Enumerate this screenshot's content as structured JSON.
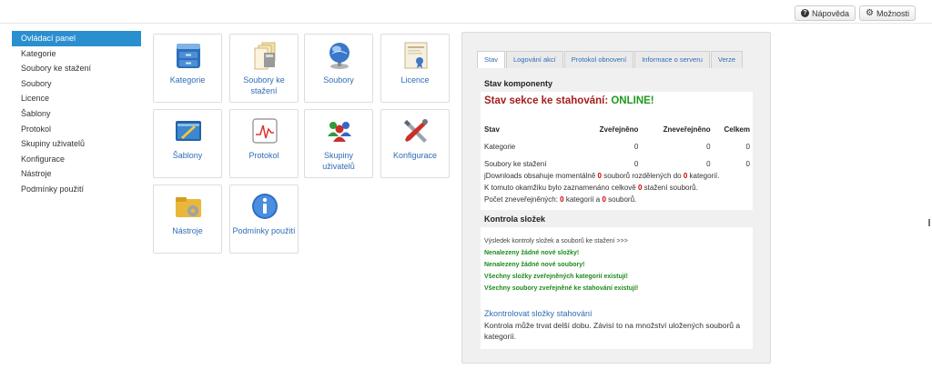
{
  "header": {
    "help_label": "Nápověda",
    "options_label": "Možnosti"
  },
  "sidebar": {
    "items": [
      {
        "label": "Ovládací panel"
      },
      {
        "label": "Kategorie"
      },
      {
        "label": "Soubory ke stažení"
      },
      {
        "label": "Soubory"
      },
      {
        "label": "Licence"
      },
      {
        "label": "Šablony"
      },
      {
        "label": "Protokol"
      },
      {
        "label": "Skupiny uživatelů"
      },
      {
        "label": "Konfigurace"
      },
      {
        "label": "Nástroje"
      },
      {
        "label": "Podmínky použití"
      }
    ]
  },
  "tiles": [
    {
      "label": "Kategorie",
      "icon": "cabinet-icon"
    },
    {
      "label": "Soubory ke stažení",
      "icon": "files-icon"
    },
    {
      "label": "Soubory",
      "icon": "globe-icon"
    },
    {
      "label": "Licence",
      "icon": "certificate-icon"
    },
    {
      "label": "Šablony",
      "icon": "template-icon"
    },
    {
      "label": "Protokol",
      "icon": "chart-log-icon"
    },
    {
      "label": "Skupiny uživatelů",
      "icon": "users-icon"
    },
    {
      "label": "Konfigurace",
      "icon": "tools-icon"
    },
    {
      "label": "Nástroje",
      "icon": "gear-folder-icon"
    },
    {
      "label": "Podmínky použití",
      "icon": "info-icon"
    }
  ],
  "panel": {
    "tabs": [
      {
        "label": "Stav"
      },
      {
        "label": "Logování akcí"
      },
      {
        "label": "Protokol obnovení"
      },
      {
        "label": "Informace o serveru"
      },
      {
        "label": "Verze"
      }
    ],
    "status_title": "Stav komponenty",
    "online_prefix": "Stav sekce ke stahování: ",
    "online_value": "ONLINE!",
    "table": {
      "headers": [
        "Stav",
        "Zveřejněno",
        "Zneveřejněno",
        "Celkem"
      ],
      "rows": [
        [
          "Kategorie",
          "0",
          "0",
          "0"
        ],
        [
          "Soubory ke stažení",
          "0",
          "0",
          "0"
        ]
      ]
    },
    "info": {
      "l1a": "jDownloads obsahuje momentálně ",
      "l1b": "0",
      "l1c": " souborů rozdělených do ",
      "l1d": "0",
      "l1e": " kategorií.",
      "l2a": "K tomuto okamžiku bylo zaznamenáno celkově ",
      "l2b": "0",
      "l2c": " stažení souborů.",
      "l3a": "Počet zneveřejněných: ",
      "l3b": "0",
      "l3c": " kategorií a ",
      "l3d": "0",
      "l3e": " souborů."
    },
    "check_title": "Kontrola složek",
    "check_result_header": "Výsledek kontroly složek a souborů ke stažení >>>",
    "check_results": [
      "Nenalezeny žádné nové složky!",
      "Nenalezeny žádné nové soubory!",
      "Všechny složky zveřejněných kategorií existují!",
      "Všechny soubory zveřejněné ke stahování existují!"
    ],
    "check_link": "Zkontrolovat složky stahování",
    "check_note": "Kontrola může trvat delší dobu. Závisí to na množství uložených souborů a kategorií."
  },
  "colors": {
    "accent": "#2a8fcf",
    "link": "#2f6db5",
    "online_label": "#a51d1d",
    "online_value": "#1c9b1c",
    "ok_text": "#1c8a1c",
    "count_red": "#cc0000"
  }
}
